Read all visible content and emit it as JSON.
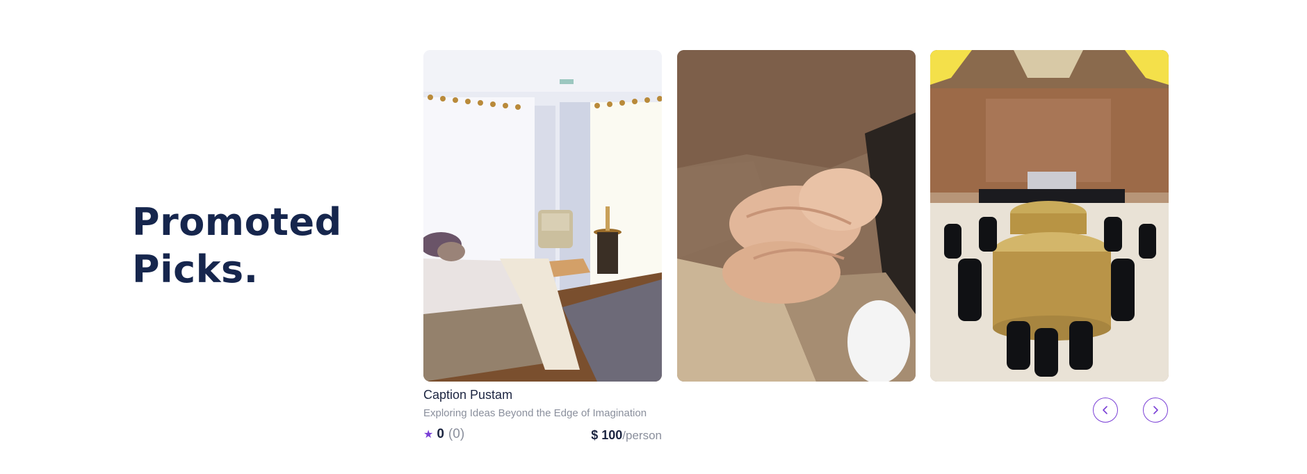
{
  "section": {
    "title_line1": "Promoted",
    "title_line2": "Picks."
  },
  "cards": [
    {
      "image": "bedroom-photo",
      "title": "Caption Pustam",
      "subtitle": "Exploring Ideas Beyond the Edge of Imagination",
      "rating": "0",
      "rating_count": "(0)",
      "price": "$ 100",
      "price_unit": "/person"
    },
    {
      "image": "holding-hands-photo"
    },
    {
      "image": "banquet-hall-photo"
    }
  ],
  "nav": {
    "prev_icon": "chevron-left-icon",
    "next_icon": "chevron-right-icon"
  },
  "colors": {
    "heading": "#16264d",
    "accent": "#7a3fd6",
    "muted": "#8a8f9c"
  }
}
